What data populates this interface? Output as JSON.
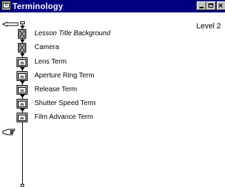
{
  "window": {
    "title": "Terminology"
  },
  "level_label": "Level 2",
  "flow": [
    {
      "label": "Lesson Title Background",
      "icon": "erase-icon",
      "italic": true
    },
    {
      "label": "Camera",
      "icon": "erase-icon",
      "italic": false
    },
    {
      "label": "Lens Term",
      "icon": "map-icon",
      "italic": false
    },
    {
      "label": "Aperture Ring Term",
      "icon": "map-icon",
      "italic": false
    },
    {
      "label": "Release Term",
      "icon": "map-icon",
      "italic": false
    },
    {
      "label": "Shutter Speed Term",
      "icon": "map-icon",
      "italic": false
    },
    {
      "label": "Film Advance Term",
      "icon": "map-icon",
      "italic": false
    }
  ]
}
